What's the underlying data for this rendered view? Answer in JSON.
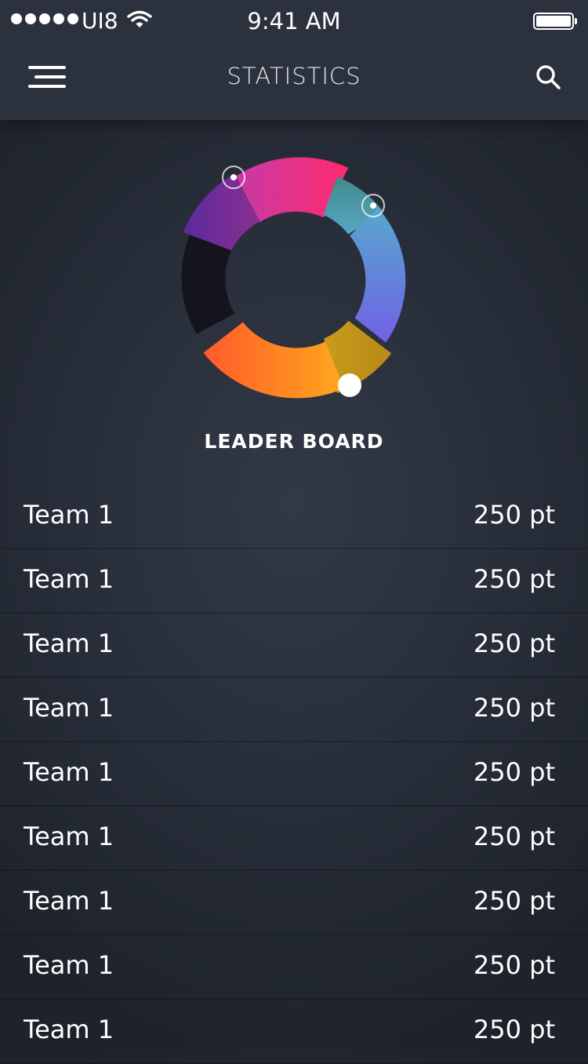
{
  "status_bar": {
    "carrier": "UI8",
    "time": "9:41 AM"
  },
  "nav": {
    "title": "STATISTICS",
    "menu_icon": "menu-icon",
    "search_icon": "search-icon"
  },
  "chart": {
    "segment_colors": [
      "#6b2fa3",
      "#d42e9a",
      "#4a8e96",
      "#6a6fe0",
      "#c8901b",
      "#ff8a1f",
      "#13131b"
    ]
  },
  "leaderboard": {
    "title": "LEADER BOARD",
    "rows": [
      {
        "name": "Team 1",
        "points": "250 pt"
      },
      {
        "name": "Team 1",
        "points": "250 pt"
      },
      {
        "name": "Team 1",
        "points": "250 pt"
      },
      {
        "name": "Team 1",
        "points": "250 pt"
      },
      {
        "name": "Team 1",
        "points": "250 pt"
      },
      {
        "name": "Team 1",
        "points": "250 pt"
      },
      {
        "name": "Team 1",
        "points": "250 pt"
      },
      {
        "name": "Team 1",
        "points": "250 pt"
      },
      {
        "name": "Team 1",
        "points": "250 pt"
      }
    ]
  }
}
